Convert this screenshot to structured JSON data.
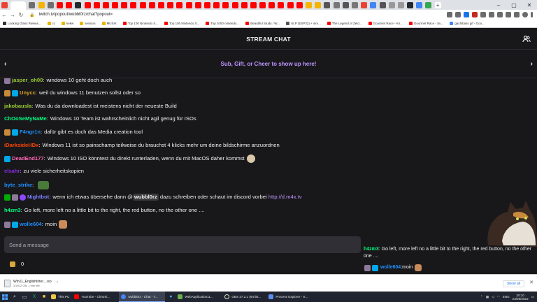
{
  "browser": {
    "url": "twitch.tv/popout/wubbl0rz/chat?popout=",
    "bookmarks": [
      "Looking Glass Releas...",
      "cc",
      "kekw",
      "session",
      "MUSIK",
      "Top 100 Nintendo S...",
      "Top 100 Nintendo S...",
      "Top 1000 nintendo...",
      "Beautiful Study / W...",
      "ULP (ESP32) + sim...",
      "The Legend of Zeld...",
      "Gourmet Race - Kir...",
      "Gourmet Race - Su...",
      "gachibass gif - Goo..."
    ]
  },
  "chat": {
    "title": "STREAM CHAT",
    "promo": "Sub, Gift, or Cheer to show up here!",
    "messages": [
      {
        "user": "jasper_oh00",
        "text": "windows 10 geht doch auch",
        "color": "#9acd32"
      },
      {
        "user": "Unycc",
        "text": "weil du windows 11 benutzen sollst oder so",
        "color": "#daa520"
      },
      {
        "user": "jakobausla",
        "text": "Was du da downloadest ist meistens nicht der neueste Build",
        "color": "#9acd32"
      },
      {
        "user": "ChOoSeMyNaMe",
        "text": "Windows 10 Team ist wahrscheinlich nicht agil genug für ISOs",
        "color": "#00ff7f"
      },
      {
        "user": "F4ngr1n",
        "text": "dafür gibt es doch das Media creation tool",
        "color": "#1e90ff"
      },
      {
        "user": "iDarksideHDx",
        "text": "Windows 11 ist so painschamp teilweise du brauchst 4 klicks mehr um deine bildschirme anzuordnen",
        "color": "#ff4500"
      },
      {
        "user": "DeadEnd177",
        "text": "Windows 10 ISO könntest du direkt runterladen, wenn du mit MacOS daher kommst",
        "color": "#ff69b4"
      },
      {
        "user": "elsahr",
        "text": "zu viele sicherheitskopien",
        "color": "#8a2be2"
      },
      {
        "user": "byte_strike",
        "text": "",
        "color": "#1e90ff"
      },
      {
        "user": "Nightbot",
        "text_before": "wenn ich etwas übersehe dann @",
        "mention": "wubbl0rz",
        "text_after": " dazu schreiben oder schaut im discord vorbei ",
        "link": "http://d.m4x.tv",
        "color": "#7c7cff"
      },
      {
        "user": "h4zm3",
        "text": "Go left, more left no a little bit to the right, the red button, no the other one ....",
        "color": "#00ff7f"
      },
      {
        "user": "wolle604",
        "text": "moin",
        "color": "#1e90ff"
      }
    ],
    "composer_placeholder": "Send a message",
    "points": "0"
  },
  "overlay": {
    "h4zm3_user": "h4zm3",
    "h4zm3_text": "Go left, more left no a little bit to the right, the red button, no the other one ....",
    "wolle_user": "wolle604",
    "wolle_text": "moin"
  },
  "downloads": {
    "file": "Win11_EnglishInter....iso",
    "status": "3.5/5.2 GB, 1 min left",
    "show_all": "Show all"
  },
  "taskbar": {
    "apps": [
      "This PC",
      "YouTube - Chromi...",
      "wubbl0rz - Chat - T...",
      "WebApplication11...",
      "OBS 27.2.1 (64-bit...",
      "Process Explorer - S..."
    ],
    "lang": "ENG",
    "time": "20:10",
    "date": "23/06/2022"
  }
}
